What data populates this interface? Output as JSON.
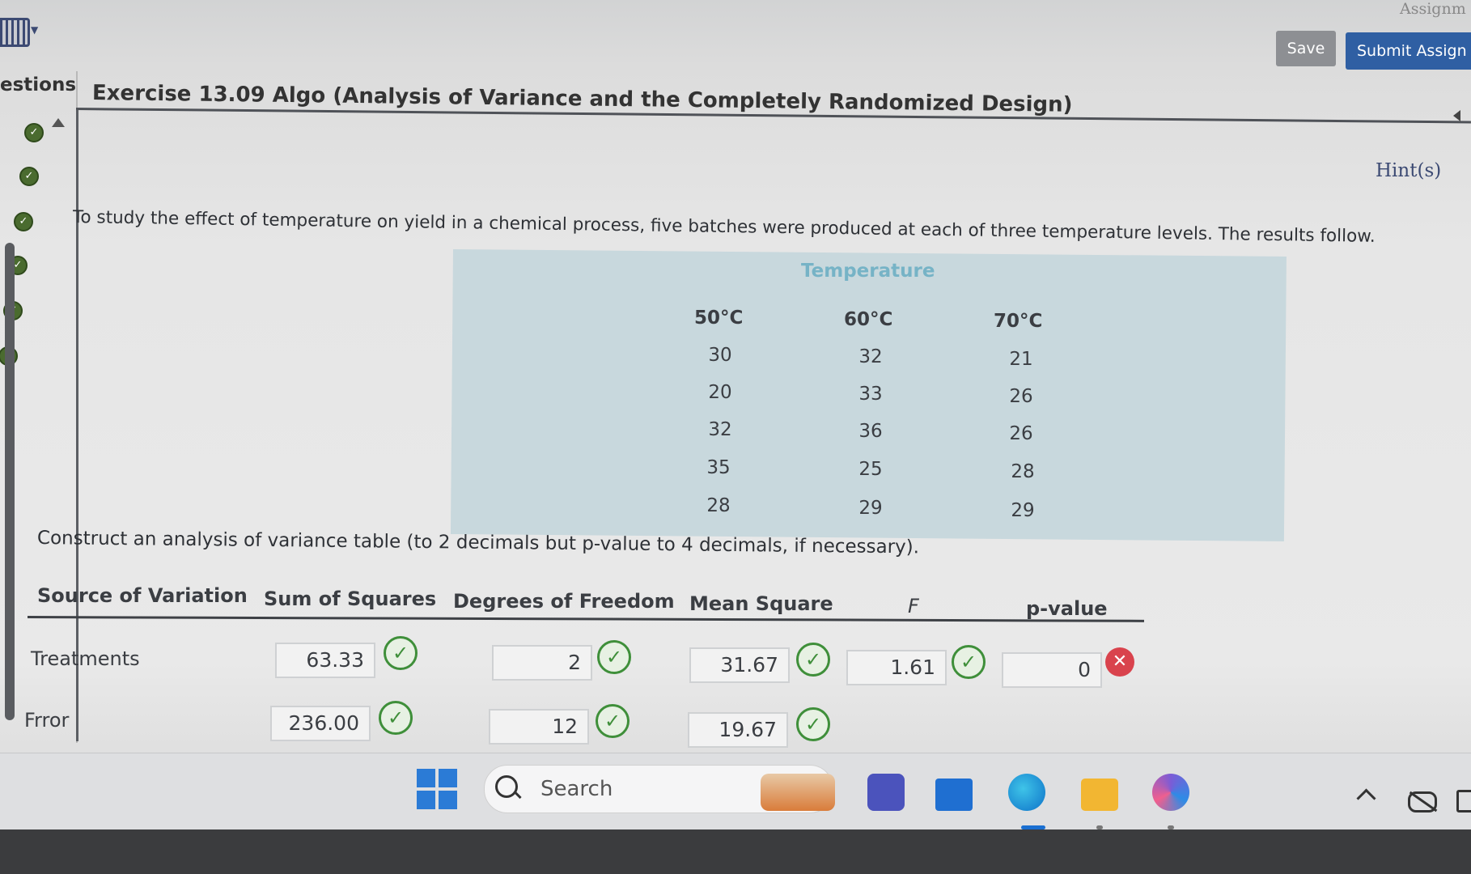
{
  "app": {
    "assignment_label": "Assignm",
    "save_label": "Save",
    "submit_label": "Submit Assign"
  },
  "sidebar": {
    "title": "estions",
    "items": [
      {
        "status": "answered"
      },
      {
        "status": "answered"
      },
      {
        "status": "answered"
      },
      {
        "status": "answered"
      },
      {
        "status": "answered"
      },
      {
        "status": "answered"
      }
    ]
  },
  "exercise": {
    "title": "Exercise 13.09 Algo (Analysis of Variance and the Completely Randomized Design)",
    "hint_label": "Hint(s)",
    "intro": "To study the effect of temperature on yield in a chemical process, five batches were produced at each of three temperature levels. The results follow.",
    "instruction": "Construct an analysis of variance table (to 2 decimals but p-value to 4 decimals, if necessary)."
  },
  "data_table": {
    "group_title": "Temperature",
    "columns": [
      "50°C",
      "60°C",
      "70°C"
    ],
    "rows": [
      [
        "30",
        "32",
        "21"
      ],
      [
        "20",
        "33",
        "26"
      ],
      [
        "32",
        "36",
        "26"
      ],
      [
        "35",
        "25",
        "28"
      ],
      [
        "28",
        "29",
        "29"
      ]
    ]
  },
  "anova": {
    "headers": {
      "source": "Source of Variation",
      "ss": "Sum of Squares",
      "df": "Degrees of Freedom",
      "ms": "Mean Square",
      "f": "F",
      "p": "p-value"
    },
    "rows": [
      {
        "label": "Treatments",
        "ss": "63.33",
        "df": "2",
        "ms": "31.67",
        "f": "1.61",
        "p": "0"
      },
      {
        "label": "Frror",
        "ss": "236.00",
        "df": "12",
        "ms": "19.67"
      }
    ],
    "status_colors": {
      "correct": "#3f8f3a",
      "incorrect": "#d9434d"
    }
  },
  "taskbar": {
    "search_placeholder": "Search",
    "apps": [
      "windows-start-icon",
      "widgets-icon",
      "teams-icon",
      "mail-icon",
      "edge-icon",
      "file-explorer-icon",
      "copilot-icon"
    ]
  }
}
